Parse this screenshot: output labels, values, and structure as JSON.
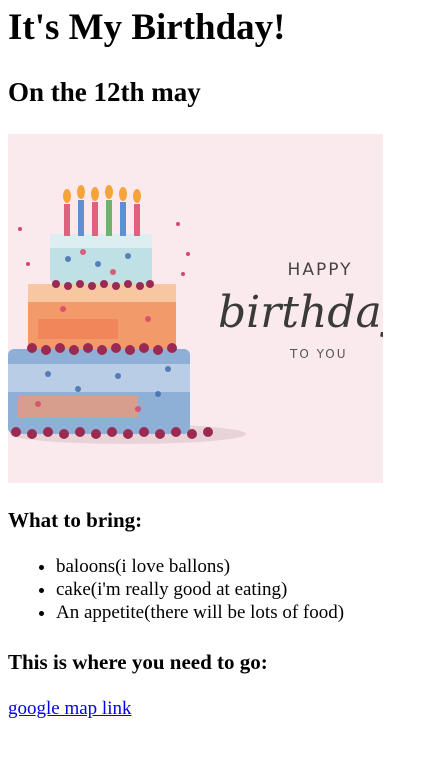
{
  "heading": "It's My Birthday!",
  "date": "On the 12th may",
  "image": {
    "alt": "watercolor birthday cake with candles and happy birthday lettering",
    "lettering": [
      "HAPPY",
      "birthday",
      "TO YOU"
    ]
  },
  "bring": {
    "heading": "What to bring:",
    "items": [
      "baloons(i love ballons)",
      "cake(i'm really good at eating)",
      "An appetite(there will be lots of food)"
    ]
  },
  "location": {
    "heading": "This is where you need to go:",
    "link_text": "google map link"
  },
  "colors": {
    "link": "#0000ee",
    "image_background": "#fbe9ec"
  }
}
